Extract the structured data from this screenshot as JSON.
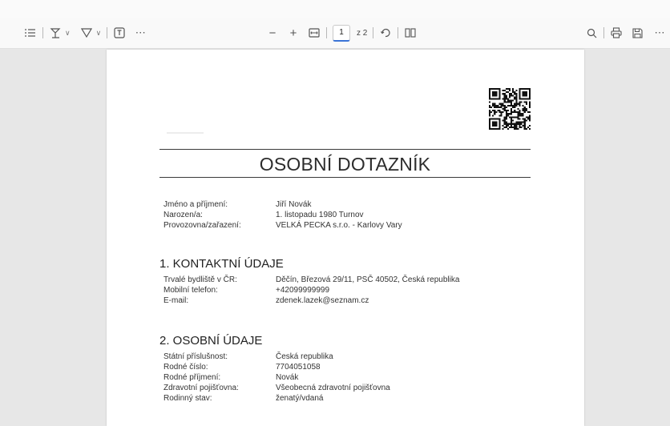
{
  "toolbar": {
    "icons": [
      "contents-icon",
      "draw-icon",
      "highlight-icon",
      "text-box-icon",
      "more-icon",
      "zoom-out-icon",
      "zoom-in-icon",
      "fit-page-icon",
      "rotate-icon",
      "page-view-icon",
      "search-icon",
      "print-icon",
      "save-icon",
      "more-options-icon"
    ],
    "current_page": "1",
    "page_count": "z 2"
  },
  "document": {
    "title": "OSOBNÍ DOTAZNÍK",
    "header": [
      {
        "label": "Jméno a příjmení:",
        "value": "Jiří Novák"
      },
      {
        "label": "Narozen/a:",
        "value": "1. listopadu 1980 Turnov"
      },
      {
        "label": "Provozovna/zařazení:",
        "value": "VELKÁ PECKA s.r.o. - Karlovy Vary"
      }
    ],
    "sections": [
      {
        "title": "1. KONTAKTNÍ ÚDAJE",
        "fields": [
          {
            "label": "Trvalé bydliště v ČR:",
            "value": "Děčín, Březová 29/11, PSČ 40502, Česká republika"
          },
          {
            "label": "Mobilní telefon:",
            "value": "+42099999999"
          },
          {
            "label": "E-mail:",
            "value": "zdenek.lazek@seznam.cz"
          }
        ]
      },
      {
        "title": "2. OSOBNÍ ÚDAJE",
        "fields": [
          {
            "label": "Státní příslušnost:",
            "value": "Česká republika"
          },
          {
            "label": "Rodné číslo:",
            "value": "7704051058"
          },
          {
            "label": "Rodné příjmení:",
            "value": "Novák"
          },
          {
            "label": "Zdravotní pojišťovna:",
            "value": "Všeobecná zdravotní pojišťovna"
          },
          {
            "label": "Rodinný stav:",
            "value": "ženatý/vdaná"
          }
        ]
      }
    ]
  },
  "colors": {
    "accent": "#3b74d6",
    "toolbar_bg": "#f9f9f9",
    "viewer_bg": "#e7e7e7"
  }
}
